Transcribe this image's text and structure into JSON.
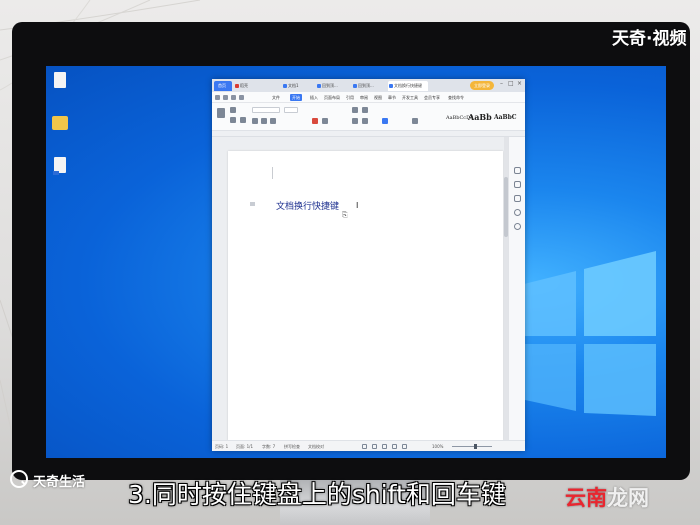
{
  "watermark": {
    "top_right": "天奇·视频",
    "bottom_left": "天奇生活",
    "corner_part1": "云南",
    "corner_part2": "龙网"
  },
  "subtitle": "3.同时按住键盘上的shift和回车键",
  "wps": {
    "tabs": [
      {
        "label": "首页",
        "icon": "home-icon"
      },
      {
        "label": "稻壳",
        "icon": "docer-icon"
      },
      {
        "label": "文档1",
        "icon": "doc-icon"
      },
      {
        "label": "回到顶...",
        "icon": "doc-icon"
      },
      {
        "label": "回到顶...",
        "icon": "doc-icon"
      },
      {
        "label": "文档换行快捷键",
        "icon": "doc-icon"
      }
    ],
    "login_label": "立即登录",
    "menu": [
      "文件",
      "开始",
      "插入",
      "页面布局",
      "引用",
      "审阅",
      "视图",
      "章节",
      "开发工具",
      "会员专享",
      "查找命令"
    ],
    "active_menu": "开始",
    "styles": [
      "AaBbCcDd",
      "AaBb",
      "AaBbC"
    ],
    "document_text": "文档换行快捷键",
    "status": {
      "page": "页码: 1",
      "pages": "页面: 1/1",
      "words": "字数: 7",
      "spell": "拼写检查",
      "doc_check": "文档校对",
      "zoom": "100%"
    }
  },
  "colors": {
    "desktop": "#0a63d9",
    "accent": "#3a78f2",
    "subtitle": "#ffffff",
    "corner_red": "#e9262f"
  }
}
